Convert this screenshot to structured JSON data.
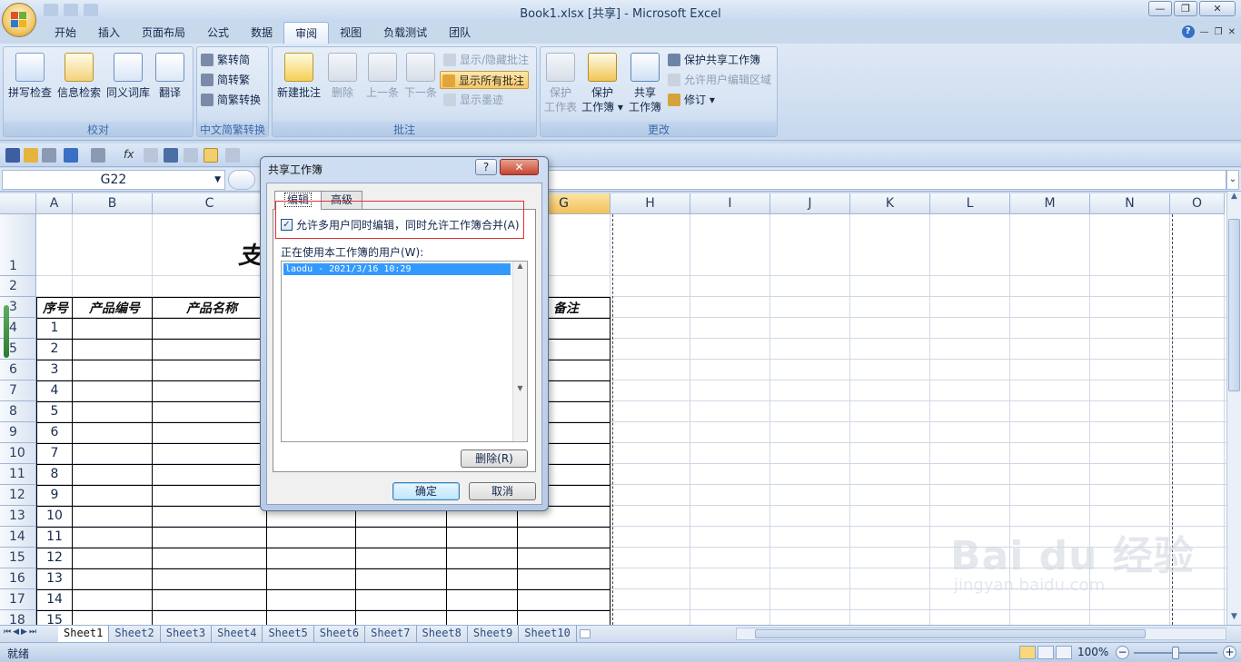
{
  "window": {
    "title": "Book1.xlsx  [共享] - Microsoft Excel",
    "controls": [
      "—",
      "❐",
      "✕"
    ]
  },
  "tabs": [
    {
      "label": "开始"
    },
    {
      "label": "插入"
    },
    {
      "label": "页面布局"
    },
    {
      "label": "公式"
    },
    {
      "label": "数据"
    },
    {
      "label": "审阅",
      "active": true
    },
    {
      "label": "视图"
    },
    {
      "label": "负载测试"
    },
    {
      "label": "团队"
    }
  ],
  "ribbon": {
    "groups": {
      "proofing": {
        "label": "校对",
        "buttons": [
          "拼写检查",
          "信息检索",
          "同义词库",
          "翻译"
        ]
      },
      "chinese": {
        "label": "中文简繁转换",
        "buttons": [
          "繁转简",
          "简转繁",
          "简繁转换"
        ]
      },
      "comments": {
        "label": "批注",
        "new": "新建批注",
        "delete": "删除",
        "prev": "上一条",
        "next": "下一条",
        "show_hide": "显示/隐藏批注",
        "show_all": "显示所有批注",
        "show_ink": "显示墨迹"
      },
      "changes": {
        "label": "更改",
        "protect_sheet": [
          "保护",
          "工作表"
        ],
        "protect_book": [
          "保护",
          "工作簿"
        ],
        "share_book": [
          "共享",
          "工作簿"
        ],
        "protect_share": "保护共享工作簿",
        "allow_edit": "允许用户编辑区域",
        "track": "修订"
      }
    }
  },
  "formula_bar": {
    "name_box": "G22",
    "fx": "fx"
  },
  "sheet": {
    "columns": [
      "A",
      "B",
      "C",
      "D",
      "E",
      "F",
      "G",
      "H",
      "I",
      "J",
      "K",
      "L",
      "M",
      "N",
      "O"
    ],
    "selected_column": "G",
    "rows": [
      "1",
      "2",
      "3",
      "4",
      "5",
      "6",
      "7",
      "8",
      "9",
      "10",
      "11",
      "12",
      "13",
      "14",
      "15",
      "16",
      "17",
      "18"
    ],
    "title_fragment": "支",
    "header_cells": {
      "a": "序号",
      "b": "产品编号",
      "c": "产品名称",
      "g": "备注"
    },
    "serials": [
      "1",
      "2",
      "3",
      "4",
      "5",
      "6",
      "7",
      "8",
      "9",
      "10",
      "11",
      "12",
      "13",
      "14",
      "15"
    ]
  },
  "sheet_tabs": [
    "Sheet1",
    "Sheet2",
    "Sheet3",
    "Sheet4",
    "Sheet5",
    "Sheet6",
    "Sheet7",
    "Sheet8",
    "Sheet9",
    "Sheet10"
  ],
  "active_sheet": "Sheet1",
  "status": {
    "ready": "就绪",
    "zoom": "100%"
  },
  "dialog": {
    "title": "共享工作簿",
    "help": "?",
    "close": "✕",
    "tabs": [
      "编辑",
      "高级"
    ],
    "allow_checkbox": {
      "label": "允许多用户同时编辑，同时允许工作簿合并(A)",
      "checked": true
    },
    "users_label": "正在使用本工作簿的用户(W):",
    "users": [
      "laodu - 2021/3/16 10:29"
    ],
    "remove_button": "删除(R)",
    "ok_button": "确定",
    "cancel_button": "取消"
  },
  "watermark": {
    "brand": "Bai du 经验",
    "url": "jingyan.baidu.com"
  }
}
